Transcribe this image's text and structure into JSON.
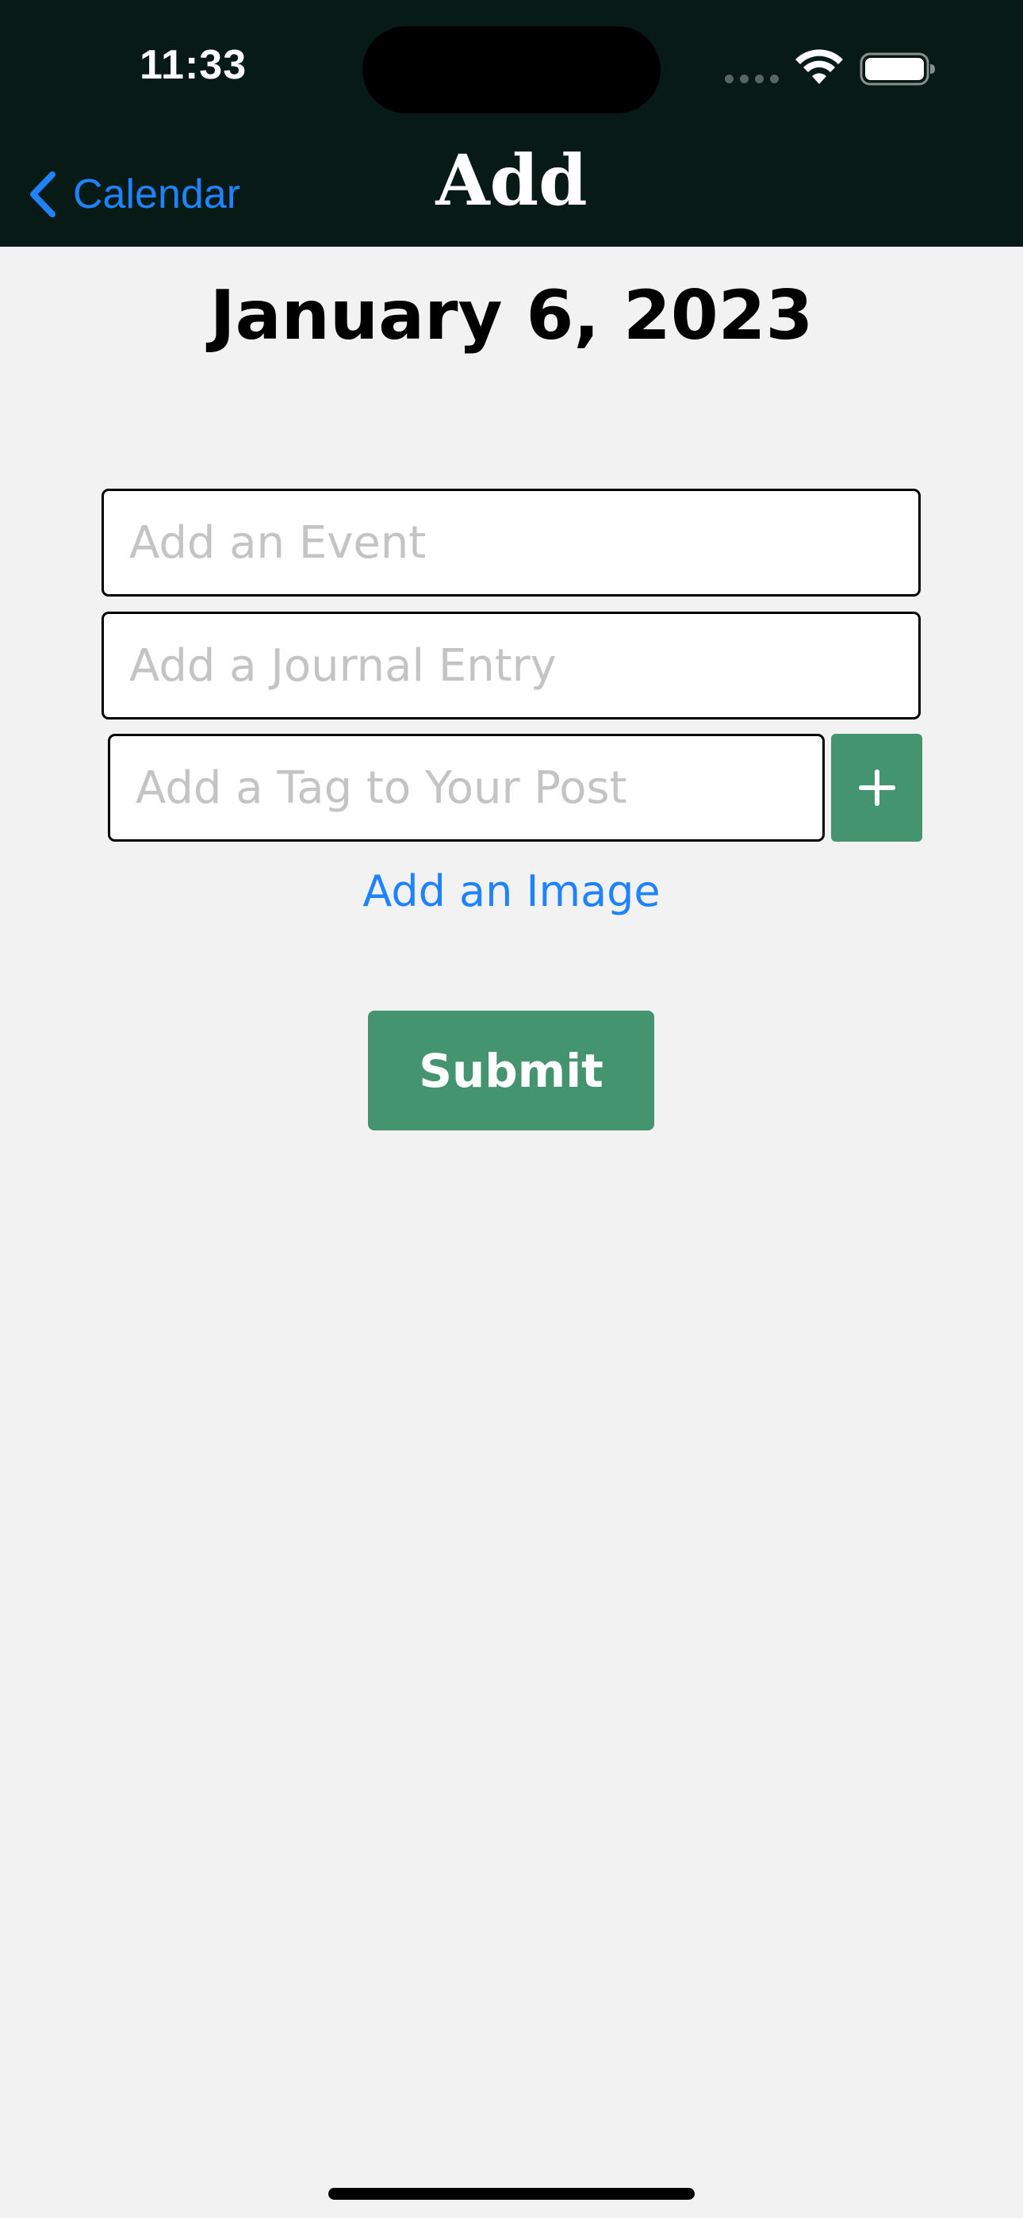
{
  "status_bar": {
    "time": "11:33"
  },
  "nav": {
    "back_label": "Calendar",
    "title": "Add"
  },
  "date_heading": "January 6, 2023",
  "form": {
    "event_placeholder": "Add an Event",
    "event_value": "",
    "journal_placeholder": "Add a Journal Entry",
    "journal_value": "",
    "tag_placeholder": "Add a Tag to Your Post",
    "tag_value": "",
    "add_image_label": "Add an Image",
    "submit_label": "Submit"
  },
  "colors": {
    "header_bg": "#081a15",
    "page_bg": "#f2f2f2",
    "accent_green": "#449470",
    "link_blue": "#1f82ff"
  },
  "icons": {
    "back": "chevron-left-icon",
    "add_tag": "plus-icon",
    "wifi": "wifi-icon",
    "battery": "battery-icon"
  }
}
